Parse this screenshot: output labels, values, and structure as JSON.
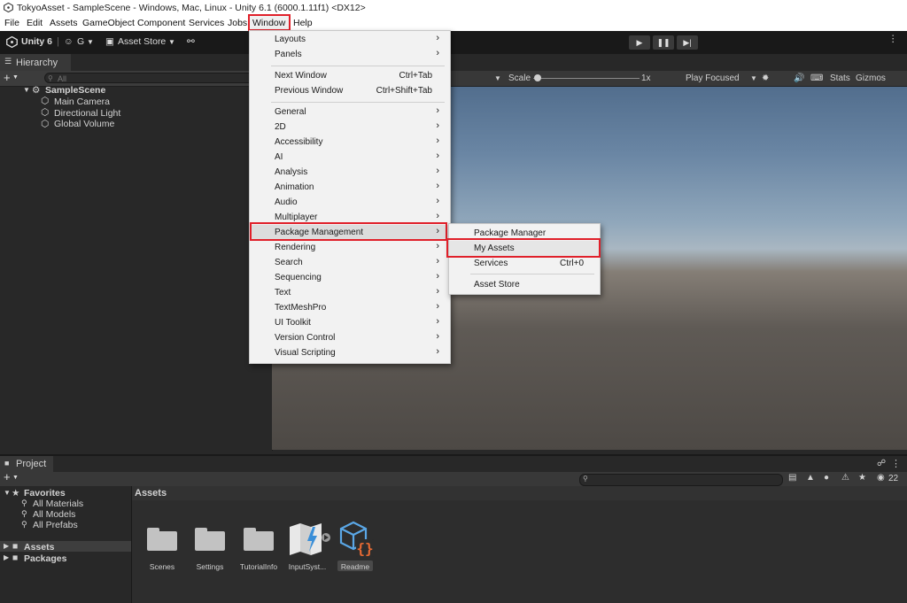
{
  "window_title": "TokyoAsset - SampleScene - Windows, Mac, Linux - Unity 6.1 (6000.1.11f1) <DX12>",
  "menubar": [
    "File",
    "Edit",
    "Assets",
    "GameObject",
    "Component",
    "Services",
    "Jobs",
    "Window",
    "Help"
  ],
  "toolbar": {
    "unity_label": "Unity 6",
    "account_label": "G",
    "asset_store_label": "Asset Store"
  },
  "hierarchy": {
    "tab": "Hierarchy",
    "search_placeholder": "All",
    "scene": "SampleScene",
    "items": [
      "Main Camera",
      "Directional Light",
      "Global Volume"
    ]
  },
  "scene_toolbar": {
    "scale_label": "Scale",
    "scale_value": "1x",
    "play_mode": "Play Focused",
    "stats": "Stats",
    "gizmos": "Gizmos"
  },
  "window_menu": {
    "items": [
      {
        "label": "Layouts",
        "submenu": true
      },
      {
        "label": "Panels",
        "submenu": true
      },
      {
        "label": "Next Window",
        "shortcut": "Ctrl+Tab"
      },
      {
        "label": "Previous Window",
        "shortcut": "Ctrl+Shift+Tab"
      },
      {
        "label": "General",
        "submenu": true
      },
      {
        "label": "2D",
        "submenu": true
      },
      {
        "label": "Accessibility",
        "submenu": true
      },
      {
        "label": "AI",
        "submenu": true
      },
      {
        "label": "Analysis",
        "submenu": true
      },
      {
        "label": "Animation",
        "submenu": true
      },
      {
        "label": "Audio",
        "submenu": true
      },
      {
        "label": "Multiplayer",
        "submenu": true
      },
      {
        "label": "Package Management",
        "submenu": true,
        "highlighted": true
      },
      {
        "label": "Rendering",
        "submenu": true
      },
      {
        "label": "Search",
        "submenu": true
      },
      {
        "label": "Sequencing",
        "submenu": true
      },
      {
        "label": "Text",
        "submenu": true
      },
      {
        "label": "TextMeshPro",
        "submenu": true
      },
      {
        "label": "UI Toolkit",
        "submenu": true
      },
      {
        "label": "Version Control",
        "submenu": true
      },
      {
        "label": "Visual Scripting",
        "submenu": true
      }
    ]
  },
  "package_submenu": {
    "items": [
      {
        "label": "Package Manager"
      },
      {
        "label": "My Assets",
        "highlighted": true
      },
      {
        "label": "Services",
        "shortcut": "Ctrl+0"
      },
      {
        "label": "Asset Store"
      }
    ]
  },
  "project": {
    "tab": "Project",
    "favorites_label": "Favorites",
    "favorites": [
      "All Materials",
      "All Models",
      "All Prefabs"
    ],
    "roots": [
      "Assets",
      "Packages"
    ],
    "assets_header": "Assets",
    "hidden_count": "22",
    "assets": [
      {
        "name": "Scenes",
        "kind": "folder"
      },
      {
        "name": "Settings",
        "kind": "folder"
      },
      {
        "name": "TutorialInfo",
        "kind": "folder"
      },
      {
        "name": "InputSyst...",
        "kind": "input-actions"
      },
      {
        "name": "Readme",
        "kind": "readme"
      }
    ]
  },
  "colors": {
    "highlight_box": "#e0202a",
    "menu_bg": "#f2f2f2",
    "editor_bg": "#282828"
  }
}
